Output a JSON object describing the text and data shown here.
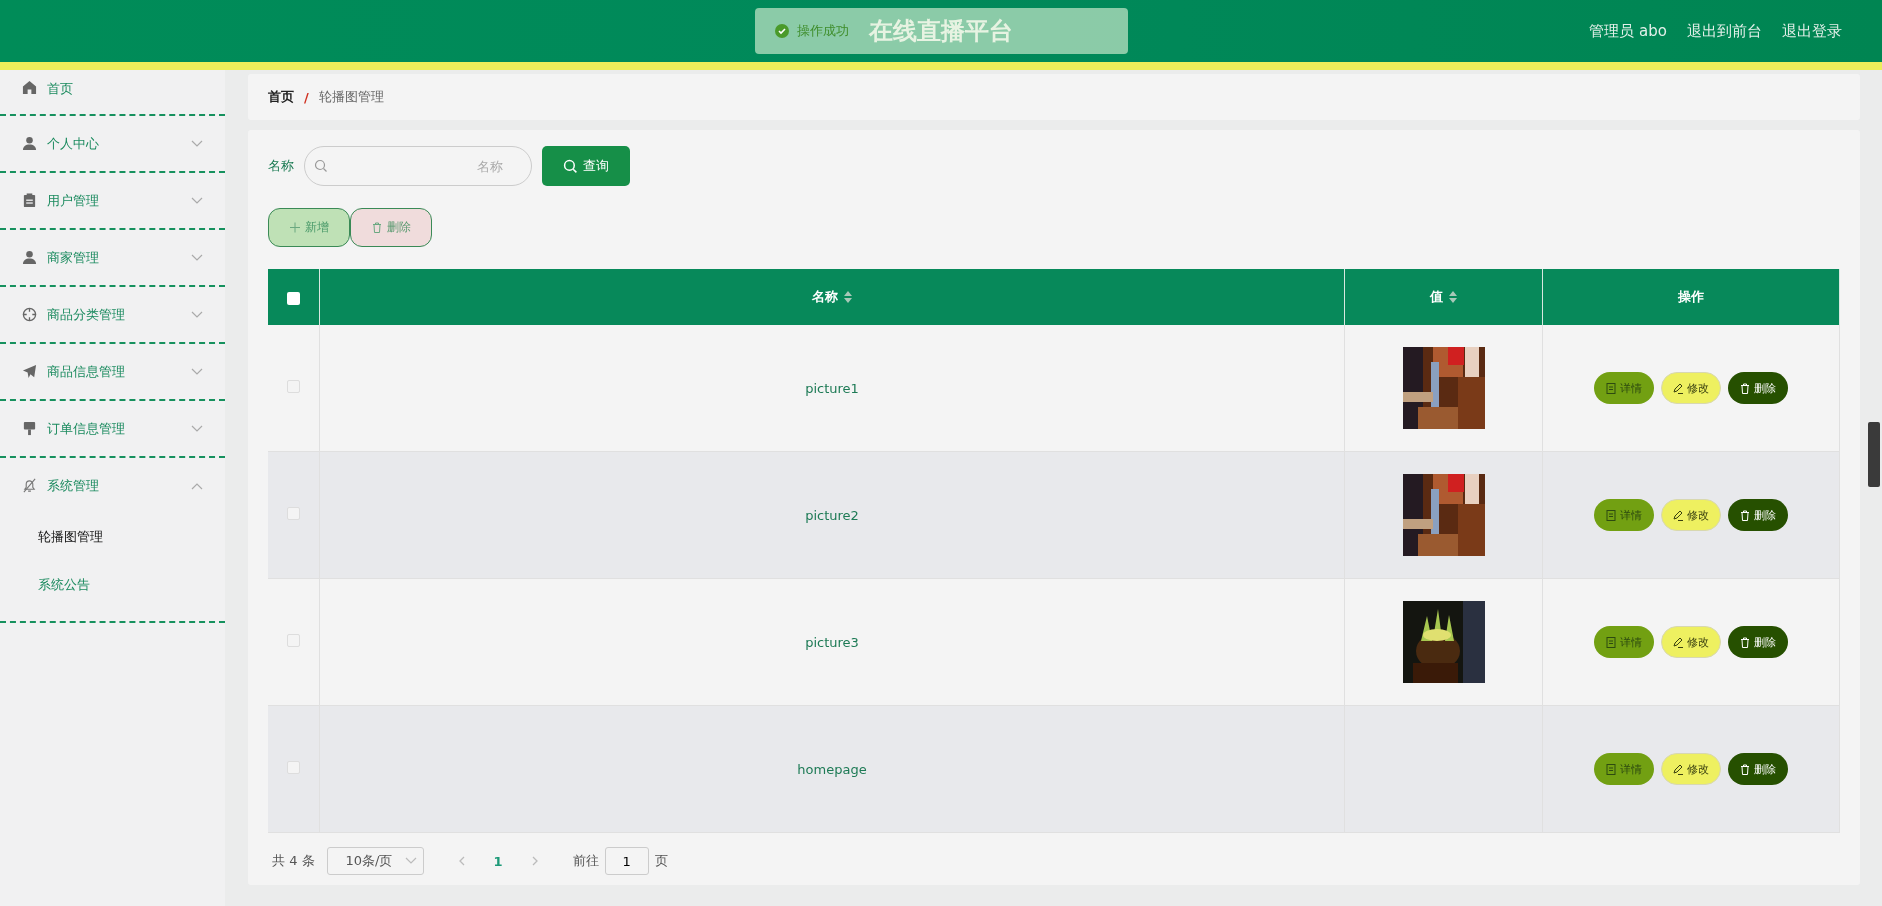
{
  "header": {
    "title": "在线直播平台",
    "toast": {
      "kind": "success",
      "text": "操作成功"
    },
    "links": [
      "管理员 abo",
      "退出到前台",
      "退出登录"
    ]
  },
  "sidebar": {
    "items": [
      {
        "label": "首页"
      },
      {
        "label": "个人中心",
        "expanded": false
      },
      {
        "label": "用户管理",
        "expanded": false
      },
      {
        "label": "商家管理",
        "expanded": false
      },
      {
        "label": "商品分类管理",
        "expanded": false
      },
      {
        "label": "商品信息管理",
        "expanded": false
      },
      {
        "label": "订单信息管理",
        "expanded": false
      },
      {
        "label": "系统管理",
        "expanded": true,
        "children": [
          {
            "label": "轮播图管理",
            "selected": true
          },
          {
            "label": "系统公告",
            "selected": false
          }
        ]
      }
    ]
  },
  "breadcrumb": {
    "separator": "/",
    "items": [
      "首页",
      "轮播图管理"
    ]
  },
  "search": {
    "label": "名称",
    "placeholder": "名称",
    "button": "查询"
  },
  "actions": [
    {
      "kind": "add",
      "label": "新增"
    },
    {
      "kind": "delete",
      "label": "删除"
    }
  ],
  "table": {
    "select_all_checked": false,
    "columns": [
      {
        "label": "名称",
        "sortable": true
      },
      {
        "label": "值",
        "sortable": true
      },
      {
        "label": "操作",
        "sortable": false
      }
    ],
    "rows": [
      {
        "checked": false,
        "name": "picture1",
        "value": {
          "kind": "picture"
        },
        "buttons": [
          {
            "kind": "detail",
            "label": "详情"
          },
          {
            "kind": "edit",
            "label": "修改"
          },
          {
            "kind": "delete",
            "label": "删除"
          }
        ]
      },
      {
        "checked": false,
        "name": "picture2",
        "value": {
          "kind": "picture"
        },
        "buttons": [
          {
            "kind": "detail",
            "label": "详情"
          },
          {
            "kind": "edit",
            "label": "修改"
          },
          {
            "kind": "delete",
            "label": "删除"
          }
        ]
      },
      {
        "checked": false,
        "name": "picture3",
        "value": {
          "kind": "picture"
        },
        "buttons": [
          {
            "kind": "detail",
            "label": "详情"
          },
          {
            "kind": "edit",
            "label": "修改"
          },
          {
            "kind": "delete",
            "label": "删除"
          }
        ]
      },
      {
        "checked": false,
        "name": "homepage",
        "buttons": [
          {
            "kind": "detail",
            "label": "详情"
          },
          {
            "kind": "edit",
            "label": "修改"
          },
          {
            "kind": "delete",
            "label": "删除"
          }
        ]
      }
    ]
  },
  "pagination": {
    "total": "共 4 条",
    "page_size": "10条/页",
    "pages": [
      {
        "label": "1",
        "selected": true
      }
    ],
    "goto_label": "前往",
    "goto_value": "1",
    "page_suffix": "页"
  }
}
